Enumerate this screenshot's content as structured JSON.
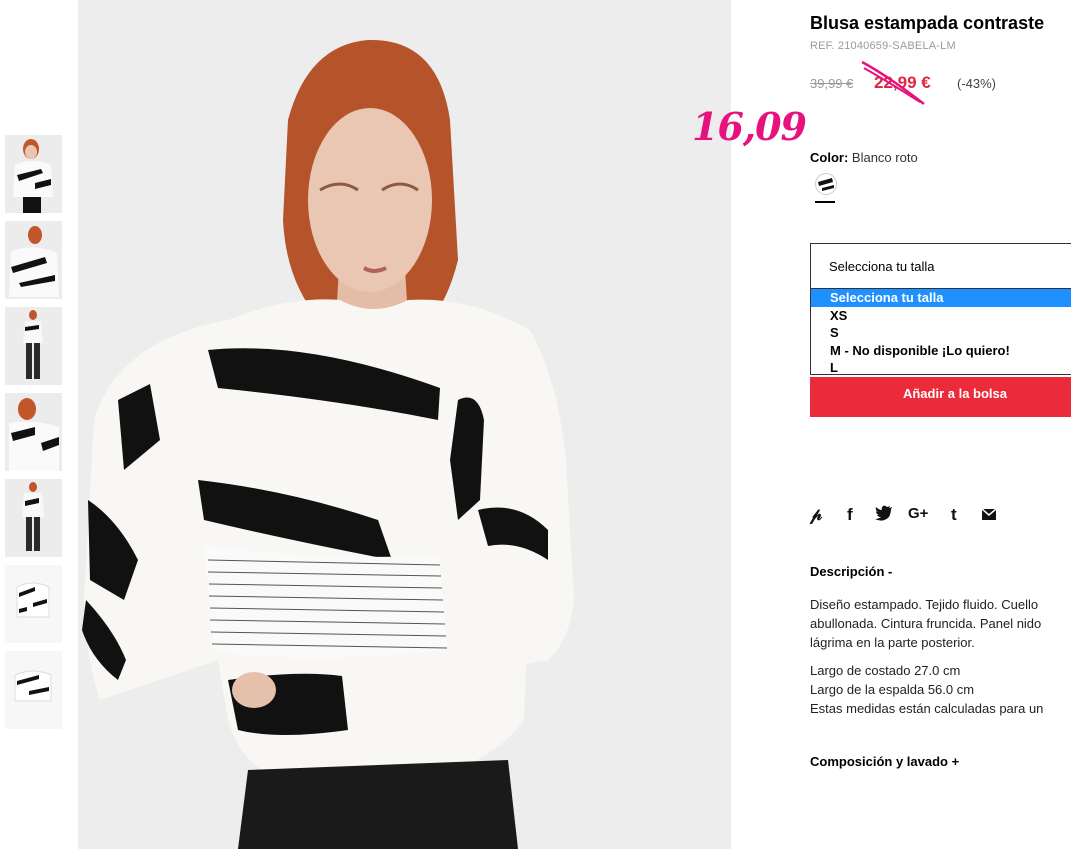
{
  "product": {
    "title": "Blusa estampada contraste",
    "ref": "REF. 21040659-SABELA-LM",
    "old_price": "39,99 €",
    "new_price": "22,99 €",
    "discount": "(-43%)",
    "handwritten_price": "16,09",
    "color_label": "Color:",
    "color_value": "Blanco roto"
  },
  "size": {
    "placeholder": "Selecciona tu talla",
    "options": [
      "Selecciona tu talla",
      "XS",
      "S",
      "M - No disponible ¡Lo quiero!",
      "L"
    ],
    "selected_index": 0
  },
  "add_to_bag": "Añadir a la bolsa",
  "social": [
    {
      "icon": "pinterest-icon",
      "glyph": "𝓅"
    },
    {
      "icon": "facebook-icon",
      "glyph": "f"
    },
    {
      "icon": "twitter-icon",
      "glyph": "🐦"
    },
    {
      "icon": "google-plus-icon",
      "glyph": "G+"
    },
    {
      "icon": "tumblr-icon",
      "glyph": "t"
    },
    {
      "icon": "email-icon",
      "glyph": "✉"
    }
  ],
  "description": {
    "title": "Descripción -",
    "lines": [
      "Diseño estampado. Tejido fluido. Cuello",
      "abullonada. Cintura fruncida. Panel nido",
      "lágrima en la parte posterior."
    ],
    "measures": [
      "Largo de costado 27.0 cm",
      "Largo de la espalda 56.0 cm",
      "Estas medidas están calculadas para un"
    ]
  },
  "composition_title": "Composición y lavado +",
  "colors": {
    "accent_red": "#ec2b3a",
    "price_red": "#e0263c",
    "handwritten_pink": "#e6127e",
    "select_highlight": "#1e90ff"
  }
}
